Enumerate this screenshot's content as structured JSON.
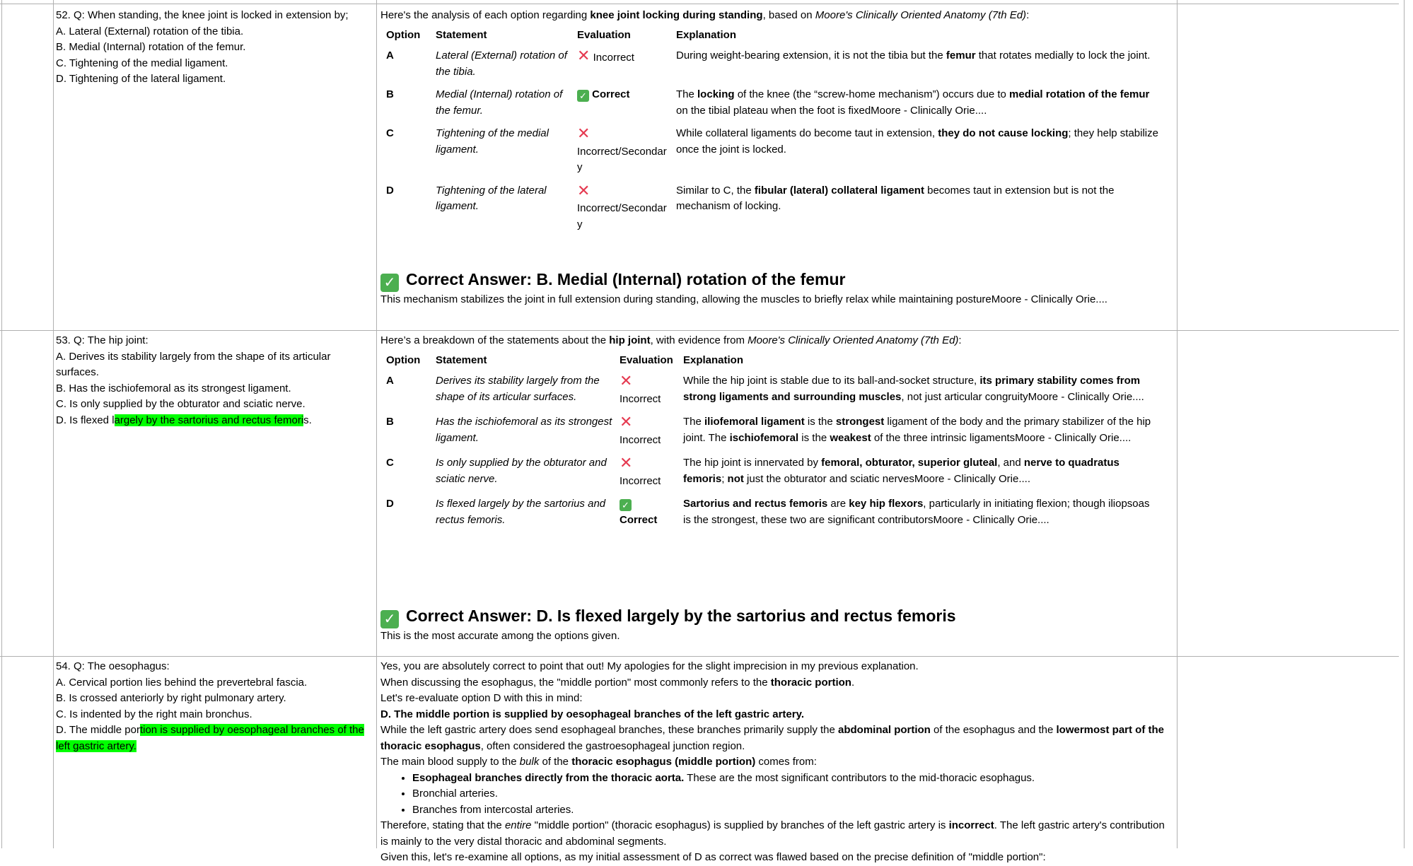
{
  "q52": {
    "question": "52. Q: When standing, the knee joint is locked in extension by;",
    "options": [
      "A. Lateral (External) rotation of the tibia.",
      "B. Medial (Internal) rotation of the femur.",
      "C. Tightening of the medial ligament.",
      "D. Tightening of the lateral ligament."
    ],
    "intro_pre": "Here's the analysis of each option regarding ",
    "intro_bold": "knee joint locking during standing",
    "intro_mid": ", based on ",
    "intro_italic": "Moore's Clinically Oriented Anatomy (7th Ed)",
    "intro_end": ":",
    "headers": {
      "option": "Option",
      "statement": "Statement",
      "evaluation": "Evaluation",
      "explanation": "Explanation"
    },
    "rows": [
      {
        "option": "A",
        "statement": "Lateral (External) rotation of the tibia.",
        "mark": "cross",
        "eval": "Incorrect",
        "e1": "During weight-bearing extension, it is not the tibia but the ",
        "e2": "femur",
        "e3": " that rotates medially to lock the joint."
      },
      {
        "option": "B",
        "statement": "Medial (Internal) rotation of the femur.",
        "mark": "check",
        "eval": "Correct",
        "e1": "The ",
        "e2": "locking",
        "e3": " of the knee (the “screw-home mechanism”) occurs due to ",
        "e4": "medial rotation of the femur",
        "e5": " on the tibial plateau when the foot is fixedMoore - Clinically Orie...."
      },
      {
        "option": "C",
        "statement": "Tightening of the medial ligament.",
        "mark": "cross",
        "eval": "Incorrect/Secondary",
        "e1": "While collateral ligaments do become taut in extension, ",
        "e2": "they do not cause locking",
        "e3": "; they help stabilize once the joint is locked."
      },
      {
        "option": "D",
        "statement": "Tightening of the lateral ligament.",
        "mark": "cross",
        "eval": "Incorrect/Secondary",
        "e1": "Similar to C, the ",
        "e2": "fibular (lateral) collateral ligament",
        "e3": " becomes taut in extension but is not the mechanism of locking."
      }
    ],
    "answer_title": "Correct Answer: B. Medial (Internal) rotation of the femur",
    "answer_note": "This mechanism stabilizes the joint in full extension during standing, allowing the muscles to briefly relax while maintaining postureMoore - Clinically Orie...."
  },
  "q53": {
    "question": "53. Q: The hip joint:",
    "options": [
      "A. Derives its stability largely from the shape of its articular surfaces.",
      "B. Has the ischiofemoral as its strongest ligament.",
      "C. Is only supplied by the obturator and sciatic nerve."
    ],
    "opt_d_pre": "D. Is flexed l",
    "opt_d_hl": "argely by the sartorius and rectus femori",
    "opt_d_post": "s.",
    "intro_pre": "Here’s a breakdown of the statements about the ",
    "intro_bold": "hip joint",
    "intro_mid": ", with evidence from ",
    "intro_italic": "Moore's Clinically Oriented Anatomy (7th Ed)",
    "intro_end": ":",
    "headers": {
      "option": "Option",
      "statement": "Statement",
      "evaluation": "Evaluation",
      "explanation": "Explanation"
    },
    "rows": [
      {
        "option": "A",
        "statement": "Derives its stability largely from the shape of its articular surfaces.",
        "mark": "cross",
        "eval": "Incorrect",
        "e1": "While the hip joint is stable due to its ball-and-socket structure, ",
        "e2": "its primary stability comes from strong ligaments and surrounding muscles",
        "e3": ", not just articular congruityMoore - Clinically Orie...."
      },
      {
        "option": "B",
        "statement": "Has the ischiofemoral as its strongest ligament.",
        "mark": "cross",
        "eval": "Incorrect",
        "e1": "The ",
        "e2": "iliofemoral ligament",
        "e3": " is the ",
        "e4": "strongest",
        "e5": " ligament of the body and the primary stabilizer of the hip joint. The ",
        "e6": "ischiofemoral",
        "e7": " is the ",
        "e8": "weakest",
        "e9": " of the three intrinsic ligamentsMoore - Clinically Orie...."
      },
      {
        "option": "C",
        "statement": "Is only supplied by the obturator and sciatic nerve.",
        "mark": "cross",
        "eval": "Incorrect",
        "e1": "The hip joint is innervated by ",
        "e2": "femoral, obturator, superior gluteal",
        "e3": ", and ",
        "e4": "nerve to quadratus femoris",
        "e5": "; ",
        "e6": "not",
        "e7": " just the obturator and sciatic nervesMoore - Clinically Orie...."
      },
      {
        "option": "D",
        "statement": "Is flexed largely by the sartorius and rectus femoris.",
        "mark": "check",
        "eval": "Correct",
        "e1": "",
        "e2": "Sartorius and rectus femoris",
        "e3": " are ",
        "e4": "key hip flexors",
        "e5": ", particularly in initiating flexion; though iliopsoas is the strongest, these two are significant contributorsMoore - Clinically Orie...."
      }
    ],
    "answer_title": "Correct Answer: D. Is flexed largely by the sartorius and rectus femoris",
    "answer_note": "This is the most accurate among the options given."
  },
  "q54": {
    "question": "54. Q: The oesophagus:",
    "options": [
      "A. Cervical portion lies behind the prevertebral fascia.",
      "B. Is crossed anteriorly by right pulmonary artery.",
      "C. Is indented by the right main bronchus."
    ],
    "opt_d_pre": "D. The middle por",
    "opt_d_hl": "tion is supplied by oesophageal branches of the left gastric artery.",
    "p1": "Yes, you are absolutely correct to point that out! My apologies for the slight imprecision in my previous explanation.",
    "p2_pre": "When discussing the esophagus, the \"middle portion\" most commonly refers to the ",
    "p2_bold": "thoracic portion",
    "p2_end": ".",
    "p3": "Let's re-evaluate option D with this in mind:",
    "p4": "D. The middle portion is supplied by oesophageal branches of the left gastric artery.",
    "p5_a": "While the left gastric artery does send esophageal branches, these branches primarily supply the ",
    "p5_b": "abdominal portion",
    "p5_c": " of the esophagus and the ",
    "p5_d": "lowermost part of the thoracic esophagus",
    "p5_e": ", often considered the gastroesophageal junction region.",
    "p6_a": "The main blood supply to the ",
    "p6_b": "bulk",
    "p6_c": " of the ",
    "p6_d": "thoracic esophagus (middle portion)",
    "p6_e": " comes from:",
    "b1_bold": "Esophageal branches directly from the thoracic aorta.",
    "b1_rest": " These are the most significant contributors to the mid-thoracic esophagus.",
    "b2": "Bronchial arteries.",
    "b3": "Branches from intercostal arteries.",
    "p7_a": "Therefore, stating that the ",
    "p7_b": "entire",
    "p7_c": " \"middle portion\" (thoracic esophagus) is supplied by branches of the left gastric artery is ",
    "p7_d": "incorrect",
    "p7_e": ". The left gastric artery's contribution is mainly to the very distal thoracic and abdominal segments.",
    "p8": "Given this, let's re-examine all options, as my initial assessment of D as correct was flawed based on the precise definition of \"middle portion\":"
  },
  "symbols": {
    "check": "✓",
    "cross": "✕"
  },
  "colors": {
    "highlight": "#00ff00",
    "check": "#4caf50",
    "cross": "#e53950",
    "grid": "#b0b0b0"
  }
}
